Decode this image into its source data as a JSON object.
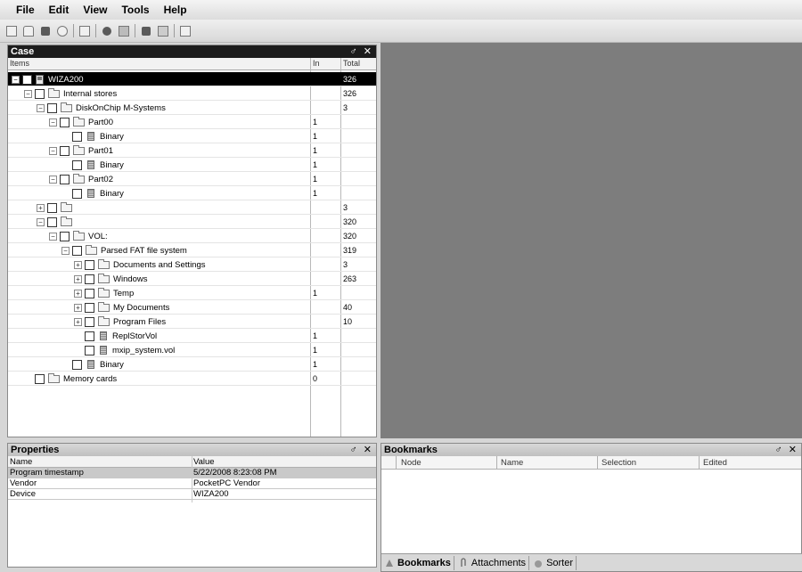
{
  "menu": [
    "File",
    "Edit",
    "View",
    "Tools",
    "Help"
  ],
  "toolbar": [
    "new-icon",
    "open-icon",
    "save-icon",
    "settings-icon",
    "copy-icon",
    "find-icon",
    "flag-icon",
    "export-icon",
    "import-icon",
    "check-icon"
  ],
  "case_panel": {
    "title": "Case",
    "controls": "♂ ✕",
    "col_items": "Items",
    "col_in": "In",
    "col_total": "Total",
    "rows": [
      {
        "label": "WIZA200",
        "in": "",
        "total": "326",
        "depth": 0,
        "icon": "device",
        "selected": true
      },
      {
        "label": "Internal stores",
        "in": "",
        "total": "326",
        "depth": 1,
        "icon": "folder"
      },
      {
        "label": "DiskOnChip M-Systems",
        "in": "",
        "total": "3",
        "depth": 2,
        "icon": "folder"
      },
      {
        "label": "Part00",
        "in": "1",
        "total": "",
        "depth": 3,
        "icon": "folder"
      },
      {
        "label": "Binary",
        "in": "1",
        "total": "",
        "depth": 4,
        "icon": "file"
      },
      {
        "label": "Part01",
        "in": "1",
        "total": "",
        "depth": 3,
        "icon": "folder"
      },
      {
        "label": "Binary",
        "in": "1",
        "total": "",
        "depth": 4,
        "icon": "file"
      },
      {
        "label": "Part02",
        "in": "1",
        "total": "",
        "depth": 3,
        "icon": "folder"
      },
      {
        "label": "Binary",
        "in": "1",
        "total": "",
        "depth": 4,
        "icon": "file"
      },
      {
        "label": "",
        "in": "",
        "total": "3",
        "depth": 2,
        "icon": "folder"
      },
      {
        "label": "",
        "in": "",
        "total": "320",
        "depth": 2,
        "icon": "folder"
      },
      {
        "label": "VOL:",
        "in": "",
        "total": "320",
        "depth": 3,
        "icon": "folder"
      },
      {
        "label": "Parsed FAT file system",
        "in": "",
        "total": "319",
        "depth": 4,
        "icon": "folder"
      },
      {
        "label": "Documents and Settings",
        "in": "",
        "total": "3",
        "depth": 5,
        "icon": "folder"
      },
      {
        "label": "Windows",
        "in": "",
        "total": "263",
        "depth": 5,
        "icon": "folder"
      },
      {
        "label": "Temp",
        "in": "1",
        "total": "",
        "depth": 5,
        "icon": "folder"
      },
      {
        "label": "My Documents",
        "in": "",
        "total": "40",
        "depth": 5,
        "icon": "folder"
      },
      {
        "label": "Program Files",
        "in": "",
        "total": "10",
        "depth": 5,
        "icon": "folder"
      },
      {
        "label": "ReplStorVol",
        "in": "1",
        "total": "",
        "depth": 5,
        "icon": "file"
      },
      {
        "label": "mxip_system.vol",
        "in": "1",
        "total": "",
        "depth": 5,
        "icon": "file"
      },
      {
        "label": "Binary",
        "in": "1",
        "total": "",
        "depth": 4,
        "icon": "file"
      },
      {
        "label": "Memory cards",
        "in": "0",
        "total": "",
        "depth": 1,
        "icon": "folder"
      }
    ]
  },
  "properties_panel": {
    "title": "Properties",
    "controls": "♂ ✕",
    "col_name": "Name",
    "col_value": "Value",
    "rows": [
      {
        "name": "Program timestamp",
        "value": "5/22/2008 8:23:08 PM",
        "selected": true
      },
      {
        "name": "Vendor",
        "value": "PocketPC Vendor"
      },
      {
        "name": "Device",
        "value": "WIZA200"
      }
    ]
  },
  "bookmarks_panel": {
    "title": "Bookmarks",
    "controls": "♂ ✕",
    "columns": [
      "Node",
      "Name",
      "Selection",
      "Edited"
    ],
    "tabs": [
      {
        "label": "Bookmarks",
        "icon": "bookmark-icon",
        "active": true
      },
      {
        "label": "Attachments",
        "icon": "paperclip-icon",
        "active": false
      },
      {
        "label": "Sorter",
        "icon": "sorter-icon",
        "active": false
      }
    ]
  }
}
